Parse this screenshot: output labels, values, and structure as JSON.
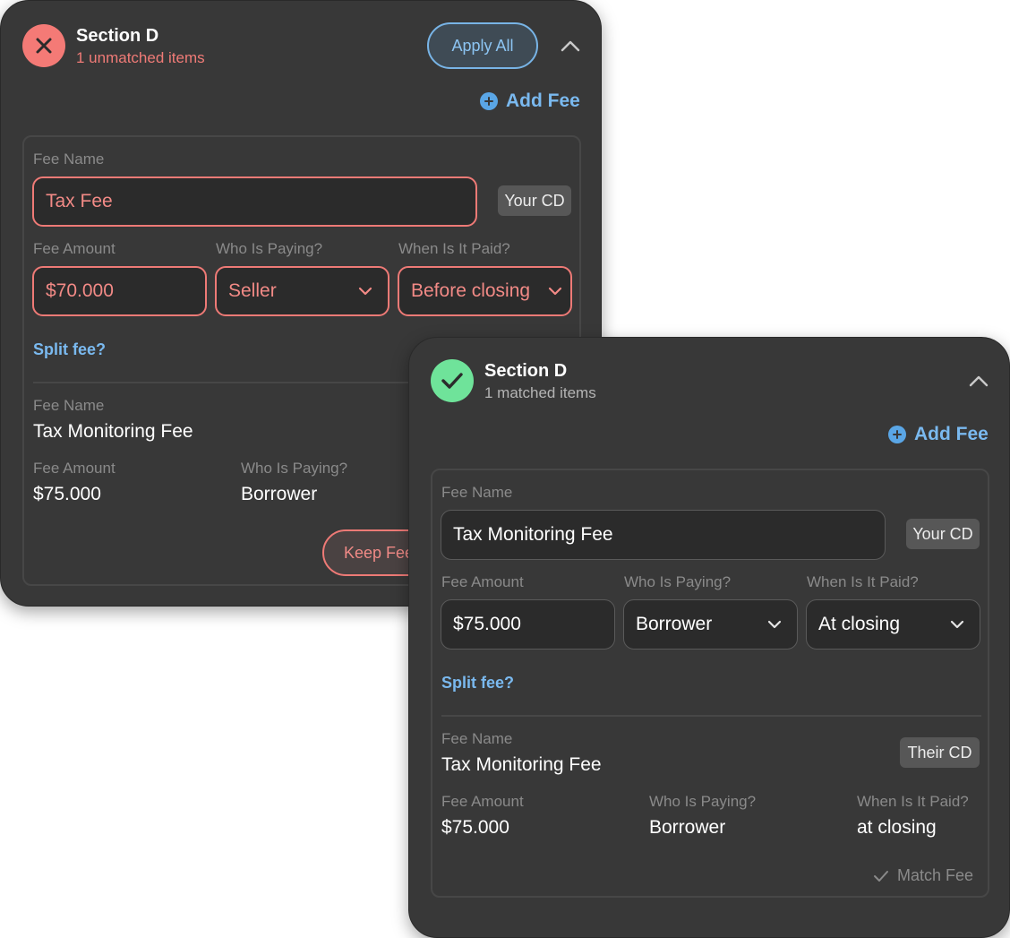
{
  "unmatched_panel": {
    "title": "Section D",
    "subtitle": "1 unmatched items",
    "apply_all_label": "Apply All",
    "add_fee_label": "Add Fee",
    "edit_fee": {
      "fee_name_label": "Fee Name",
      "fee_name_value": "Tax Fee",
      "source_tag": "Your CD",
      "fee_amount_label": "Fee Amount",
      "fee_amount_value": "$70.000",
      "who_paying_label": "Who Is Paying?",
      "who_paying_value": "Seller",
      "when_paid_label": "When Is It Paid?",
      "when_paid_value": "Before closing",
      "split_fee_label": "Split fee?"
    },
    "other_fee": {
      "fee_name_label": "Fee Name",
      "fee_name_value": "Tax Monitoring Fee",
      "fee_amount_label": "Fee Amount",
      "fee_amount_value": "$75.000",
      "who_paying_label": "Who Is Paying?",
      "who_paying_value": "Borrower",
      "keep_fee_label": "Keep Fee"
    }
  },
  "matched_panel": {
    "title": "Section D",
    "subtitle": "1 matched items",
    "add_fee_label": "Add Fee",
    "edit_fee": {
      "fee_name_label": "Fee Name",
      "fee_name_value": "Tax Monitoring Fee",
      "source_tag": "Your CD",
      "fee_amount_label": "Fee Amount",
      "fee_amount_value": "$75.000",
      "who_paying_label": "Who Is Paying?",
      "who_paying_value": "Borrower",
      "when_paid_label": "When Is It Paid?",
      "when_paid_value": "At closing",
      "split_fee_label": "Split fee?"
    },
    "their_fee": {
      "fee_name_label": "Fee Name",
      "fee_name_value": "Tax Monitoring Fee",
      "source_tag": "Their CD",
      "fee_amount_label": "Fee Amount",
      "fee_amount_value": "$75.000",
      "who_paying_label": "Who Is Paying?",
      "who_paying_value": "Borrower",
      "when_paid_label": "When Is It Paid?",
      "when_paid_value": "at closing",
      "match_fee_label": "Match Fee"
    }
  },
  "colors": {
    "panel_bg": "#383838",
    "error": "#f47a76",
    "success": "#6fe39a",
    "link": "#7ab9ef"
  },
  "icons": [
    "close-icon",
    "check-icon",
    "chevron-up-icon",
    "chevron-down-icon",
    "plus-circle-icon",
    "checkmark-icon"
  ]
}
